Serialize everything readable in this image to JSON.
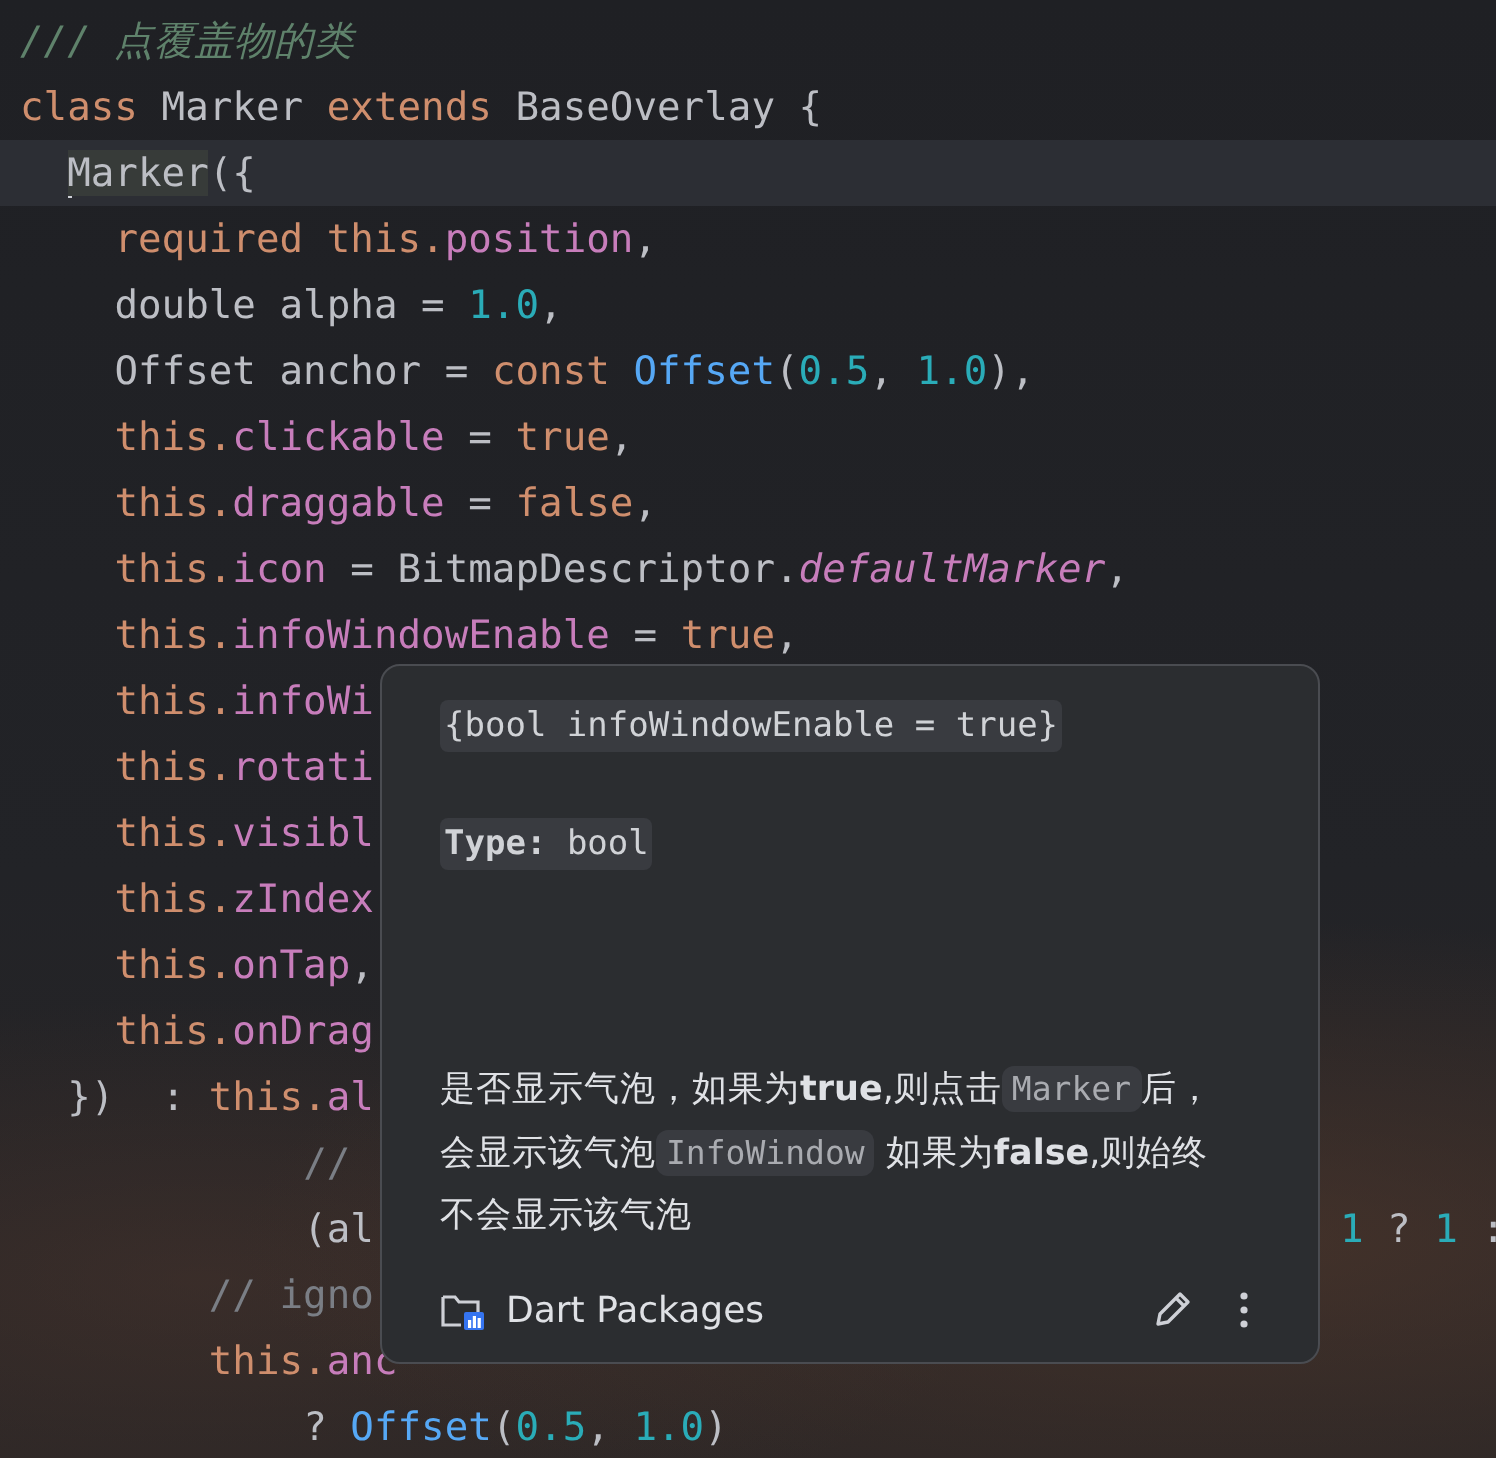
{
  "editor": {
    "lines": [
      {
        "current": false,
        "tokens": [
          {
            "kind": "doc",
            "text": "/// 点覆盖物的类"
          }
        ]
      },
      {
        "current": false,
        "tokens": [
          {
            "kind": "keyword",
            "text": "class"
          },
          {
            "kind": "plain",
            "text": " Marker "
          },
          {
            "kind": "keyword",
            "text": "extends"
          },
          {
            "kind": "plain",
            "text": " BaseOverlay {"
          }
        ]
      },
      {
        "current": true,
        "tokens": [
          {
            "kind": "usage",
            "text": "  Marker"
          },
          {
            "kind": "plain",
            "text": "({"
          }
        ]
      },
      {
        "current": false,
        "tokens": [
          {
            "kind": "keyword",
            "text": "    required this."
          },
          {
            "kind": "field",
            "text": "position"
          },
          {
            "kind": "plain",
            "text": ","
          }
        ]
      },
      {
        "current": false,
        "tokens": [
          {
            "kind": "plain",
            "text": "    double alpha = "
          },
          {
            "kind": "number",
            "text": "1.0"
          },
          {
            "kind": "plain",
            "text": ","
          }
        ]
      },
      {
        "current": false,
        "tokens": [
          {
            "kind": "plain",
            "text": "    Offset anchor = "
          },
          {
            "kind": "keyword",
            "text": "const "
          },
          {
            "kind": "ctor",
            "text": "Offset"
          },
          {
            "kind": "plain",
            "text": "("
          },
          {
            "kind": "number",
            "text": "0.5"
          },
          {
            "kind": "plain",
            "text": ", "
          },
          {
            "kind": "number",
            "text": "1.0"
          },
          {
            "kind": "plain",
            "text": "),"
          }
        ]
      },
      {
        "current": false,
        "tokens": [
          {
            "kind": "keyword",
            "text": "    this."
          },
          {
            "kind": "field",
            "text": "clickable"
          },
          {
            "kind": "plain",
            "text": " = "
          },
          {
            "kind": "keyword",
            "text": "true"
          },
          {
            "kind": "plain",
            "text": ","
          }
        ]
      },
      {
        "current": false,
        "tokens": [
          {
            "kind": "keyword",
            "text": "    this."
          },
          {
            "kind": "field",
            "text": "draggable"
          },
          {
            "kind": "plain",
            "text": " = "
          },
          {
            "kind": "keyword",
            "text": "false"
          },
          {
            "kind": "plain",
            "text": ","
          }
        ]
      },
      {
        "current": false,
        "tokens": [
          {
            "kind": "keyword",
            "text": "    this."
          },
          {
            "kind": "field",
            "text": "icon"
          },
          {
            "kind": "plain",
            "text": " = BitmapDescriptor."
          },
          {
            "kind": "static",
            "text": "defaultMarker"
          },
          {
            "kind": "plain",
            "text": ","
          }
        ]
      },
      {
        "current": false,
        "tokens": [
          {
            "kind": "keyword",
            "text": "    this."
          },
          {
            "kind": "field",
            "text": "infoWindowEnable"
          },
          {
            "kind": "plain",
            "text": " = "
          },
          {
            "kind": "keyword",
            "text": "true"
          },
          {
            "kind": "plain",
            "text": ","
          }
        ]
      },
      {
        "current": false,
        "tokens": [
          {
            "kind": "keyword",
            "text": "    this."
          },
          {
            "kind": "field",
            "text": "infoWi"
          }
        ]
      },
      {
        "current": false,
        "tokens": [
          {
            "kind": "keyword",
            "text": "    this."
          },
          {
            "kind": "field",
            "text": "rotati"
          }
        ]
      },
      {
        "current": false,
        "tokens": [
          {
            "kind": "keyword",
            "text": "    this."
          },
          {
            "kind": "field",
            "text": "visibl"
          }
        ]
      },
      {
        "current": false,
        "tokens": [
          {
            "kind": "keyword",
            "text": "    this."
          },
          {
            "kind": "field",
            "text": "zIndex"
          }
        ]
      },
      {
        "current": false,
        "tokens": [
          {
            "kind": "keyword",
            "text": "    this."
          },
          {
            "kind": "field",
            "text": "onTap"
          },
          {
            "kind": "plain",
            "text": ","
          }
        ]
      },
      {
        "current": false,
        "tokens": [
          {
            "kind": "keyword",
            "text": "    this."
          },
          {
            "kind": "field",
            "text": "onDrag"
          }
        ]
      },
      {
        "current": false,
        "tokens": [
          {
            "kind": "plain",
            "text": "  })  : "
          },
          {
            "kind": "keyword",
            "text": "this."
          },
          {
            "kind": "field",
            "text": "al"
          }
        ]
      },
      {
        "current": false,
        "tokens": [
          {
            "kind": "comment",
            "text": "            //"
          }
        ]
      },
      {
        "current": false,
        "tokens": [
          {
            "kind": "plain",
            "text": "            (al"
          }
        ],
        "tail": [
          {
            "kind": "number",
            "text": "1"
          },
          {
            "kind": "plain",
            "text": " ? "
          },
          {
            "kind": "number",
            "text": "1"
          },
          {
            "kind": "plain",
            "text": " :"
          }
        ]
      },
      {
        "current": false,
        "tokens": [
          {
            "kind": "comment",
            "text": "        // igno"
          }
        ]
      },
      {
        "current": false,
        "tokens": [
          {
            "kind": "keyword",
            "text": "        this."
          },
          {
            "kind": "field",
            "text": "anc"
          }
        ]
      },
      {
        "current": false,
        "tokens": [
          {
            "kind": "plain",
            "text": "            ? "
          },
          {
            "kind": "ctor",
            "text": "Offset"
          },
          {
            "kind": "plain",
            "text": "("
          },
          {
            "kind": "number",
            "text": "0.5"
          },
          {
            "kind": "plain",
            "text": ", "
          },
          {
            "kind": "number",
            "text": "1.0"
          },
          {
            "kind": "plain",
            "text": ")"
          }
        ]
      }
    ]
  },
  "popup": {
    "signature": "{bool infoWindowEnable = true}",
    "type_label": "Type:",
    "type_value": "bool",
    "description": [
      {
        "kind": "text",
        "text": "是否显示气泡，如果为**true**,则点击"
      },
      {
        "kind": "code",
        "text": "Marker"
      },
      {
        "kind": "text",
        "text": "后，会显示该气泡"
      },
      {
        "kind": "code",
        "text": "InfoWindow"
      },
      {
        "kind": "text",
        "text": " 如果为**false**,则始终不会显示该气泡"
      }
    ],
    "source": "Dart Packages"
  }
}
